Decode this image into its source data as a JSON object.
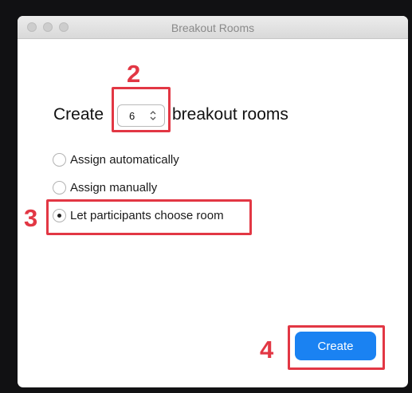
{
  "window": {
    "title": "Breakout Rooms",
    "buttons": [
      "close-button",
      "minimize-button",
      "zoom-button"
    ]
  },
  "create_row": {
    "prefix": "Create",
    "room_count": "6",
    "suffix": "breakout rooms"
  },
  "assign_options": [
    {
      "label": "Assign automatically",
      "selected": false
    },
    {
      "label": "Assign manually",
      "selected": false
    },
    {
      "label": "Let participants choose room",
      "selected": true
    }
  ],
  "footer": {
    "create_label": "Create"
  },
  "annotations": {
    "steps": [
      "2",
      "3",
      "4"
    ],
    "color": "#e23744"
  },
  "colors": {
    "accent": "#1a82f2",
    "window_background": "#ffffff",
    "backdrop": "#111113"
  }
}
